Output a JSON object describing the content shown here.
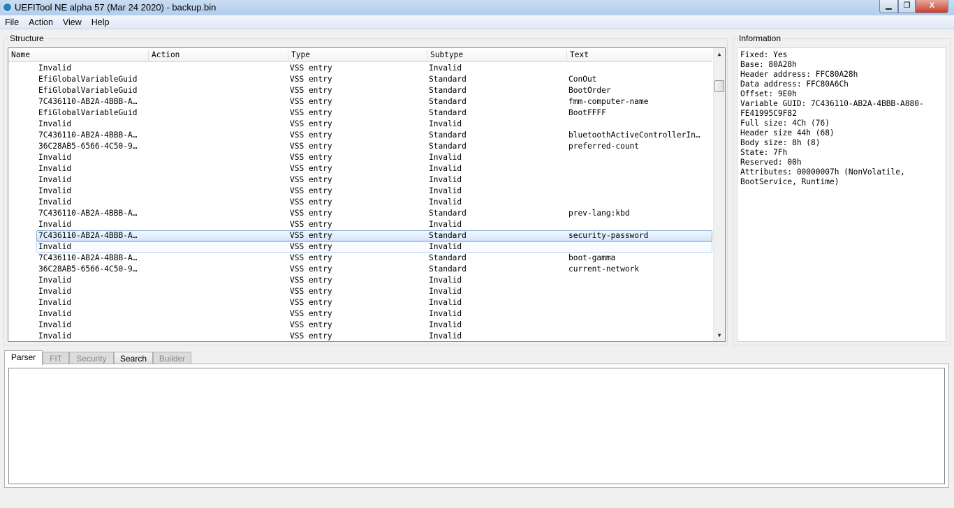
{
  "window": {
    "title": "UEFITool NE alpha 57 (Mar 24 2020) - backup.bin",
    "minimize": "▁",
    "maximize": "❐",
    "close": "X"
  },
  "menu": [
    "File",
    "Action",
    "View",
    "Help"
  ],
  "structure": {
    "label": "Structure",
    "columns": [
      "Name",
      "Action",
      "Type",
      "Subtype",
      "Text"
    ],
    "rows": [
      [
        "Invalid",
        "",
        "VSS entry",
        "Invalid",
        ""
      ],
      [
        "EfiGlobalVariableGuid",
        "",
        "VSS entry",
        "Standard",
        "ConOut"
      ],
      [
        "EfiGlobalVariableGuid",
        "",
        "VSS entry",
        "Standard",
        "BootOrder"
      ],
      [
        "7C436110-AB2A-4BBB-A…",
        "",
        "VSS entry",
        "Standard",
        "fmm-computer-name"
      ],
      [
        "EfiGlobalVariableGuid",
        "",
        "VSS entry",
        "Standard",
        "BootFFFF"
      ],
      [
        "Invalid",
        "",
        "VSS entry",
        "Invalid",
        ""
      ],
      [
        "7C436110-AB2A-4BBB-A…",
        "",
        "VSS entry",
        "Standard",
        "bluetoothActiveControllerIn…"
      ],
      [
        "36C28AB5-6566-4C50-9…",
        "",
        "VSS entry",
        "Standard",
        "preferred-count"
      ],
      [
        "Invalid",
        "",
        "VSS entry",
        "Invalid",
        ""
      ],
      [
        "Invalid",
        "",
        "VSS entry",
        "Invalid",
        ""
      ],
      [
        "Invalid",
        "",
        "VSS entry",
        "Invalid",
        ""
      ],
      [
        "Invalid",
        "",
        "VSS entry",
        "Invalid",
        ""
      ],
      [
        "Invalid",
        "",
        "VSS entry",
        "Invalid",
        ""
      ],
      [
        "7C436110-AB2A-4BBB-A…",
        "",
        "VSS entry",
        "Standard",
        "prev-lang:kbd"
      ],
      [
        "Invalid",
        "",
        "VSS entry",
        "Invalid",
        ""
      ],
      [
        "7C436110-AB2A-4BBB-A…",
        "",
        "VSS entry",
        "Standard",
        "security-password"
      ],
      [
        "Invalid",
        "",
        "VSS entry",
        "Invalid",
        ""
      ],
      [
        "7C436110-AB2A-4BBB-A…",
        "",
        "VSS entry",
        "Standard",
        "boot-gamma"
      ],
      [
        "36C28AB5-6566-4C50-9…",
        "",
        "VSS entry",
        "Standard",
        "current-network"
      ],
      [
        "Invalid",
        "",
        "VSS entry",
        "Invalid",
        ""
      ],
      [
        "Invalid",
        "",
        "VSS entry",
        "Invalid",
        ""
      ],
      [
        "Invalid",
        "",
        "VSS entry",
        "Invalid",
        ""
      ],
      [
        "Invalid",
        "",
        "VSS entry",
        "Invalid",
        ""
      ],
      [
        "Invalid",
        "",
        "VSS entry",
        "Invalid",
        ""
      ],
      [
        "Invalid",
        "",
        "VSS entry",
        "Invalid",
        ""
      ]
    ],
    "selected_index": 15,
    "hover_index": 16
  },
  "information": {
    "label": "Information",
    "text": "Fixed: Yes\nBase: 80A28h\nHeader address: FFC80A28h\nData address: FFC80A6Ch\nOffset: 9E0h\nVariable GUID: 7C436110-AB2A-4BBB-A880-\nFE41995C9F82\nFull size: 4Ch (76)\nHeader size 44h (68)\nBody size: 8h (8)\nState: 7Fh\nReserved: 00h\nAttributes: 00000007h (NonVolatile,\nBootService, Runtime)"
  },
  "tabs": [
    {
      "label": "Parser",
      "state": "active"
    },
    {
      "label": "FIT",
      "state": "disabled"
    },
    {
      "label": "Security",
      "state": "disabled"
    },
    {
      "label": "Search",
      "state": "normal"
    },
    {
      "label": "Builder",
      "state": "disabled"
    }
  ]
}
